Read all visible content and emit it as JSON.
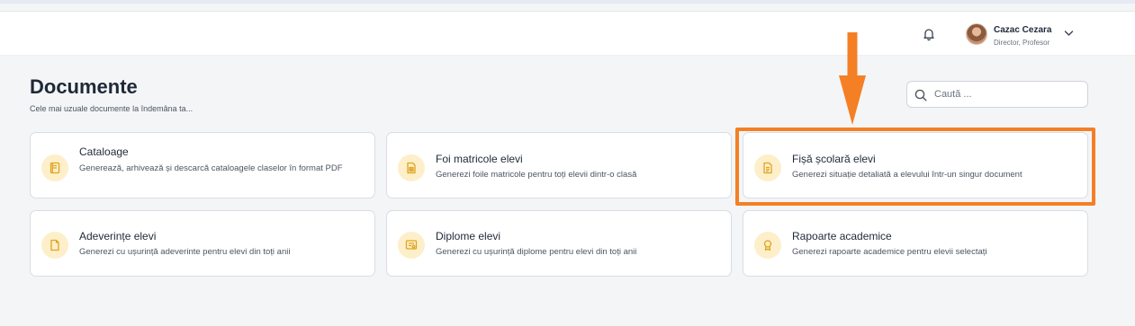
{
  "header": {
    "user_name": "Cazac Cezara",
    "user_role": "Director, Profesor"
  },
  "page": {
    "title": "Documente",
    "subtitle": "Cele mai uzuale documente la îndemâna ta..."
  },
  "search": {
    "placeholder": "Caută ..."
  },
  "cards": [
    {
      "title": "Cataloage",
      "description": "Generează, arhivează și descarcă cataloagele claselor în format PDF",
      "icon": "notebook-icon"
    },
    {
      "title": "Foi matricole elevi",
      "description": "Generezi foile matricole pentru toți elevii dintr-o clasă",
      "icon": "file-table-icon"
    },
    {
      "title": "Fișă școlară elevi",
      "description": "Generezi situație detaliată a elevului într-un singur document",
      "icon": "file-text-icon"
    },
    {
      "title": "Adeverințe elevi",
      "description": "Generezi cu ușurință adeverinte pentru elevi din toți anii",
      "icon": "file-icon"
    },
    {
      "title": "Diplome elevi",
      "description": "Generezi cu ușurință diplome pentru elevi din toți anii",
      "icon": "certificate-icon"
    },
    {
      "title": "Rapoarte academice",
      "description": "Generezi rapoarte academice pentru elevii selectați",
      "icon": "award-icon"
    }
  ],
  "colors": {
    "accent": "#f47f25",
    "icon_bg": "#fdefc9",
    "icon_stroke": "#e0a322"
  }
}
